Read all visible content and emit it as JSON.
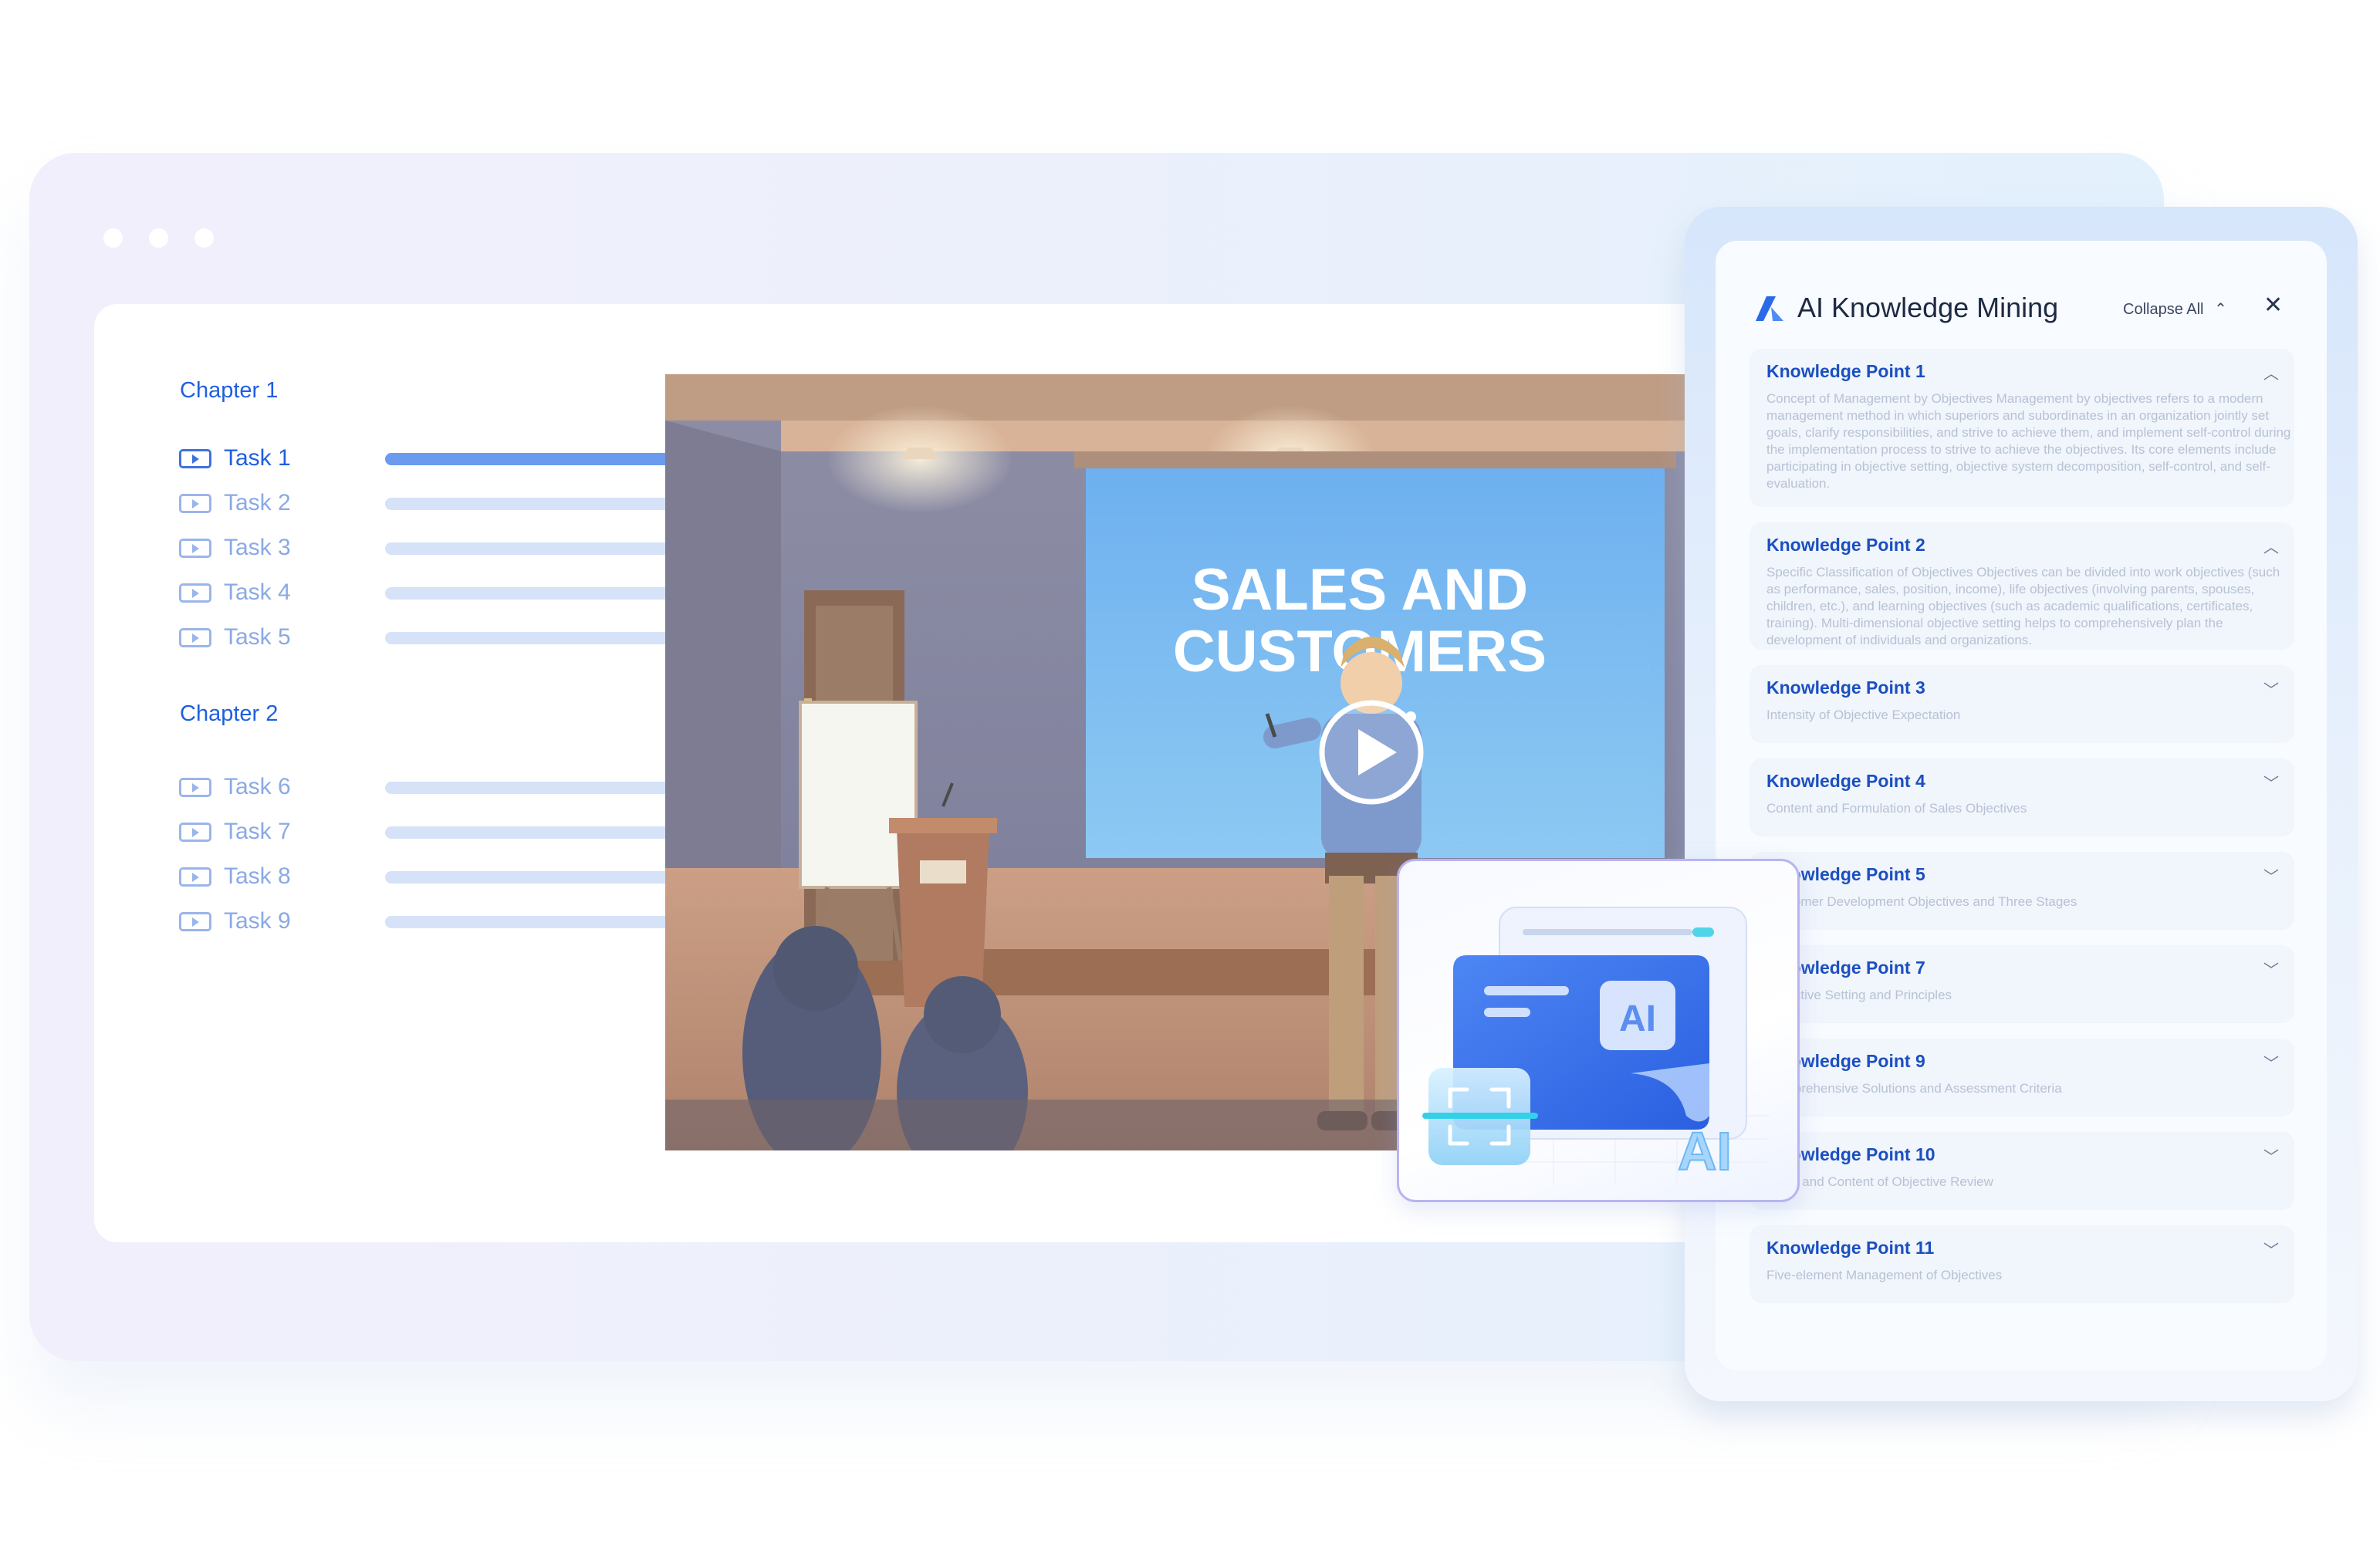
{
  "chapters": [
    {
      "title": "Chapter  1",
      "tasks": [
        "Task  1",
        "Task  2",
        "Task  3",
        "Task  4",
        "Task  5"
      ]
    },
    {
      "title": "Chapter  2",
      "tasks": [
        "Task  6",
        "Task  7",
        "Task  8",
        "Task  9"
      ]
    }
  ],
  "active_task": "Task  1",
  "video": {
    "screen_line1": "SALES AND",
    "screen_line2": "CUSTOMERS"
  },
  "panel": {
    "title": "AI Knowledge Mining",
    "collapse_label": "Collapse All",
    "points": [
      {
        "title": "Knowledge Point 1",
        "desc": "Concept of Management by Objectives Management by objectives refers to a modern management method in which superiors and subordinates in an organization jointly set goals, clarify responsibilities, and strive to achieve them, and implement self-control during the implementation process to strive to achieve the objectives. Its core elements include participating in objective setting, objective system decomposition, self-control, and self-evaluation.",
        "expanded": true
      },
      {
        "title": "Knowledge Point 2",
        "desc": "Specific Classification of Objectives Objectives can be divided into work objectives (such as performance, sales, position, income), life objectives (involving parents, spouses, children, etc.), and learning objectives (such as academic qualifications, certificates, training). Multi-dimensional objective setting helps to comprehensively plan the development of individuals and organizations.",
        "expanded": true
      },
      {
        "title": "Knowledge Point 3",
        "desc": "Intensity of Objective Expectation",
        "expanded": false
      },
      {
        "title": "Knowledge Point 4",
        "desc": "Content and Formulation of Sales Objectives",
        "expanded": false
      },
      {
        "title": "Knowledge Point 5",
        "desc": "Customer Development Objectives and Three Stages",
        "expanded": false
      },
      {
        "title": "Knowledge Point 7",
        "desc": "Objective Setting and Principles",
        "expanded": false
      },
      {
        "title": "Knowledge Point 9",
        "desc": "Comprehensive Solutions and Assessment Criteria",
        "expanded": false
      },
      {
        "title": "Knowledge Point 10",
        "desc": "Basis and Content of Objective Review",
        "expanded": false
      },
      {
        "title": "Knowledge Point 11",
        "desc": "Five-element Management of Objectives",
        "expanded": false
      }
    ]
  },
  "ai_badge": "AI",
  "colors": {
    "accent": "#1f5fe0",
    "bar_active": "#6b9bef",
    "bar_idle": "#d5e2f8",
    "ai_card_border": "#b9b4f0"
  }
}
